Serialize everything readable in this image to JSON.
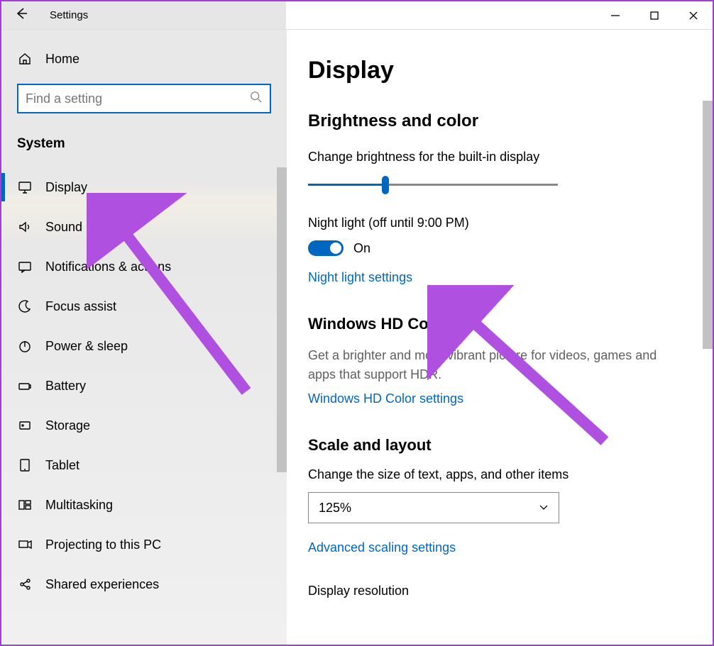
{
  "titlebar": {
    "back_label": "Back",
    "title": "Settings"
  },
  "sidebar": {
    "home_label": "Home",
    "search_placeholder": "Find a setting",
    "heading": "System",
    "items": [
      {
        "id": "display",
        "label": "Display",
        "icon": "monitor-icon",
        "active": true
      },
      {
        "id": "sound",
        "label": "Sound",
        "icon": "speaker-icon"
      },
      {
        "id": "notifications",
        "label": "Notifications & actions",
        "icon": "message-icon"
      },
      {
        "id": "focus",
        "label": "Focus assist",
        "icon": "moon-icon"
      },
      {
        "id": "power",
        "label": "Power & sleep",
        "icon": "power-icon"
      },
      {
        "id": "battery",
        "label": "Battery",
        "icon": "battery-icon"
      },
      {
        "id": "storage",
        "label": "Storage",
        "icon": "storage-icon"
      },
      {
        "id": "tablet",
        "label": "Tablet",
        "icon": "tablet-icon"
      },
      {
        "id": "multitasking",
        "label": "Multitasking",
        "icon": "multitask-icon"
      },
      {
        "id": "projecting",
        "label": "Projecting to this PC",
        "icon": "project-icon"
      },
      {
        "id": "shared",
        "label": "Shared experiences",
        "icon": "share-icon"
      }
    ]
  },
  "main": {
    "page_title": "Display",
    "section1_title": "Brightness and color",
    "brightness_label": "Change brightness for the built-in display",
    "brightness_value_percent": 31,
    "nightlight_label": "Night light (off until 9:00 PM)",
    "nightlight_state": "On",
    "nightlight_link": "Night light settings",
    "hd_title": "Windows HD Color",
    "hd_desc": "Get a brighter and more vibrant picture for videos, games and apps that support HDR.",
    "hd_link": "Windows HD Color settings",
    "scale_title": "Scale and layout",
    "scale_label": "Change the size of text, apps, and other items",
    "scale_value": "125%",
    "scale_link": "Advanced scaling settings",
    "resolution_label": "Display resolution"
  },
  "colors": {
    "accent": "#0067c0",
    "annotation": "#b050e0"
  }
}
